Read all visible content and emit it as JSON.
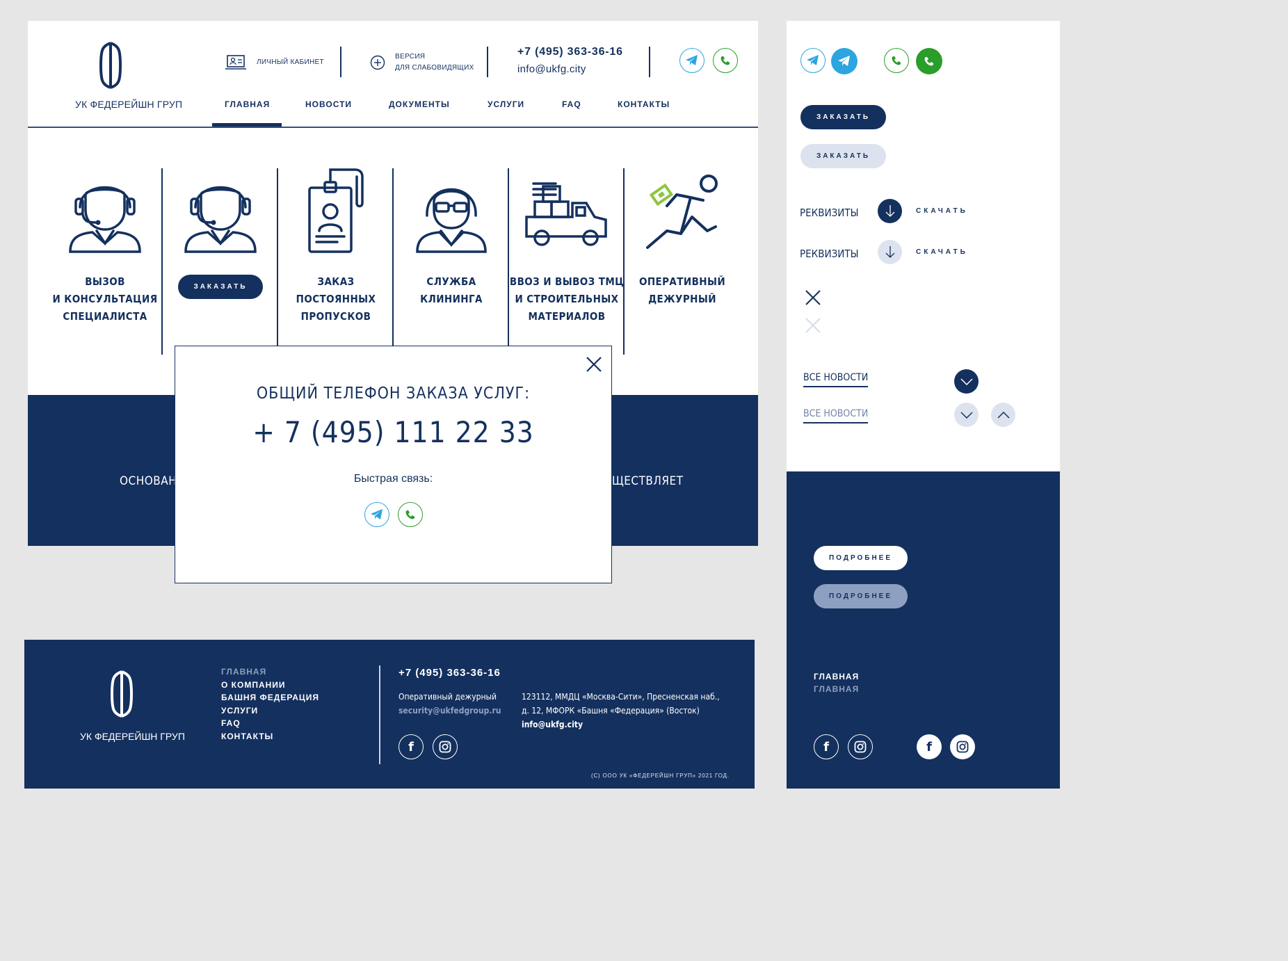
{
  "header": {
    "logo_text": "УК ФЕДЕРЕЙШН ГРУП",
    "cabinet_label": "ЛИЧНЫЙ КАБИНЕТ",
    "visually_impaired_line1": "ВЕРСИЯ",
    "visually_impaired_line2": "ДЛЯ СЛАБОВИДЯЩИХ",
    "phone": "+7 (495) 363-36-16",
    "email": "info@ukfg.city"
  },
  "nav": {
    "items": [
      "ГЛАВНАЯ",
      "НОВОСТИ",
      "ДОКУМЕНТЫ",
      "УСЛУГИ",
      "FAQ",
      "КОНТАКТЫ"
    ],
    "active": "ГЛАВНАЯ"
  },
  "services": [
    {
      "line1": "ВЫЗОВ",
      "line2": "И КОНСУЛЬТАЦИЯ",
      "line3": "СПЕЦИАЛИСТА",
      "icon": "operator-icon"
    },
    {
      "button": "ЗАКАЗАТЬ",
      "icon": "operator-icon"
    },
    {
      "line1": "ЗАКАЗ ПОСТОЯННЫХ",
      "line2": "ПРОПУСКОВ",
      "icon": "badge-pass-icon"
    },
    {
      "line1": "СЛУЖБА",
      "line2": "КЛИНИНГА",
      "icon": "woman-glasses-icon"
    },
    {
      "line1": "ВВОЗ И ВЫВОЗ ТМЦ",
      "line2": "И СТРОИТЕЛЬНЫХ",
      "line3": "МАТЕРИАЛОВ",
      "icon": "truck-icon"
    },
    {
      "line1": "ОПЕРАТИВНЫЙ",
      "line2": "ДЕЖУРНЫЙ",
      "icon": "running-man-icon"
    }
  ],
  "dark_band": {
    "left_fragment": "ОСНОВАНА",
    "right_fragment": "ЩЕСТВЛЯЕТ"
  },
  "popup": {
    "title": "ОБЩИЙ ТЕЛЕФОН ЗАКАЗА УСЛУГ:",
    "phone": "+ 7 (495) 111 22 33",
    "quick_label": "Быстрая связь:"
  },
  "styleguide": {
    "order_label": "ЗАКАЗАТЬ",
    "requisites_label": "РЕКВИЗИТЫ",
    "download_label": "СКАЧАТЬ",
    "all_news_label": "ВСЕ НОВОСТИ",
    "more_label": "ПОДРОБНЕЕ",
    "home_label": "ГЛАВНАЯ"
  },
  "footer": {
    "logo_text": "УК ФЕДЕРЕЙШН ГРУП",
    "links": [
      "ГЛАВНАЯ",
      "О КОМПАНИИ",
      "БАШНЯ ФЕДЕРАЦИЯ",
      "УСЛУГИ",
      "FAQ",
      "КОНТАКТЫ"
    ],
    "phone": "+7 (495) 363-36-16",
    "duty_label": "Оперативный дежурный",
    "duty_email": "security@ukfedgroup.ru",
    "address_line1": "123112, ММДЦ «Москва-Сити», Пресненская наб.,",
    "address_line2": "д. 12, МФОРК «Башня «Федерация» (Восток)",
    "email": "info@ukfg.city",
    "copyright": "(С) ООО УК «ФЕДЕРЕЙШН ГРУП» 2021 ГОД."
  },
  "colors": {
    "navy": "#14305e",
    "telegram": "#2ca5e0",
    "whatsapp": "#2a9d2a",
    "light_pill": "#dde3ee",
    "accent_green": "#8dc63f"
  }
}
